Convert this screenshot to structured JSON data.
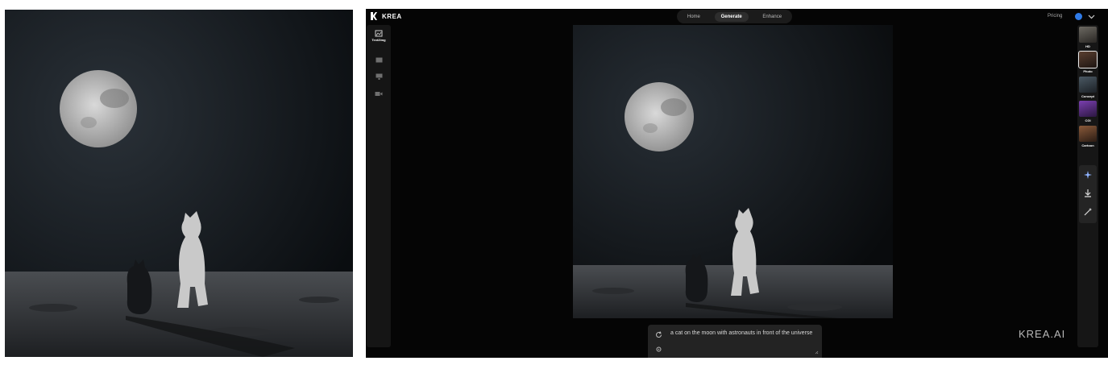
{
  "app": {
    "brand": "KREA"
  },
  "nav": {
    "tabs": [
      {
        "label": "Home",
        "active": false
      },
      {
        "label": "Generate",
        "active": true
      },
      {
        "label": "Enhance",
        "active": false
      }
    ],
    "pricing": "Pricing"
  },
  "left_toolbar": {
    "items": [
      {
        "label": "Text2Img",
        "icon": "text-to-image-icon"
      },
      {
        "icon": "image-icon"
      },
      {
        "icon": "monitor-icon"
      },
      {
        "icon": "video-icon"
      }
    ]
  },
  "styles": {
    "items": [
      {
        "label": "HD",
        "active": false
      },
      {
        "label": "Photo",
        "active": true
      },
      {
        "label": "Concept",
        "active": false
      },
      {
        "label": "CGI",
        "active": false
      },
      {
        "label": "Cartoon",
        "active": false
      }
    ]
  },
  "actions": {
    "items": [
      {
        "icon": "sparkle-icon"
      },
      {
        "icon": "download-icon"
      },
      {
        "icon": "magic-wand-icon"
      }
    ]
  },
  "prompt": {
    "text": "a cat on the moon with astronauts in front of the universe"
  },
  "watermark": "KREA.AI",
  "colors": {
    "background": "#050505",
    "panel": "#151515",
    "accent": "#2f7be8"
  }
}
